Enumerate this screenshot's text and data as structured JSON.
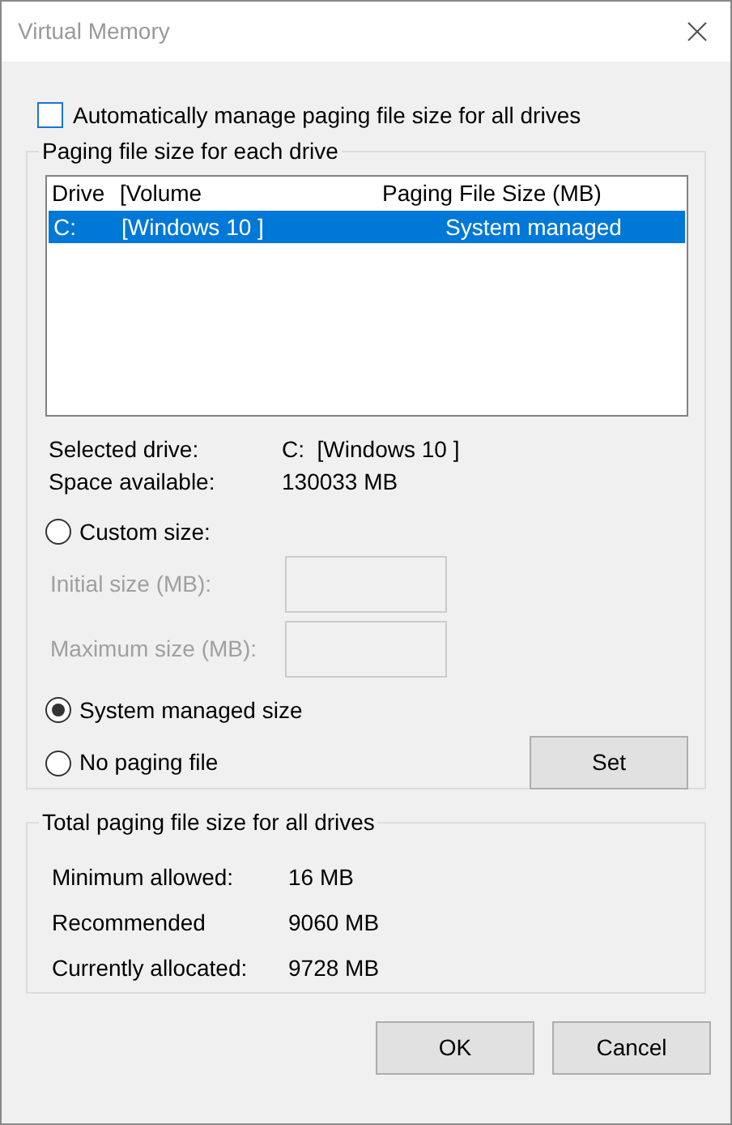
{
  "window": {
    "title": "Virtual Memory"
  },
  "auto_manage": {
    "label": "Automatically manage paging file size for all drives",
    "checked": false
  },
  "drive_group": {
    "title": "Paging file size for each drive",
    "columns": [
      "Drive",
      "[Volume",
      "Paging File Size (MB)"
    ],
    "rows": [
      {
        "drive": "C:",
        "volume": "[Windows 10 ]",
        "size": "System managed",
        "selected": true
      }
    ],
    "info": [
      {
        "label": "Selected drive:",
        "value": "C:  [Windows 10 ]"
      },
      {
        "label": "Space available:",
        "value": "130033 MB"
      }
    ],
    "options": [
      {
        "kind": "radio",
        "label": "Custom size:",
        "selected": false
      },
      {
        "kind": "field",
        "label": "Initial size (MB):",
        "disabled": true
      },
      {
        "kind": "field",
        "label": "Maximum size (MB):",
        "disabled": true
      },
      {
        "kind": "radio",
        "label": "System managed size",
        "selected": true
      },
      {
        "kind": "radio",
        "label": "No paging file",
        "selected": false
      }
    ],
    "set_button": "Set"
  },
  "total_group": {
    "title": "Total paging file size for all drives",
    "rows": [
      {
        "label": "Minimum allowed:",
        "value": "16 MB"
      },
      {
        "label": "Recommended",
        "value": "9060 MB"
      },
      {
        "label": "Currently allocated:",
        "value": "9728 MB"
      }
    ]
  },
  "buttons": [
    "OK",
    "Cancel"
  ]
}
